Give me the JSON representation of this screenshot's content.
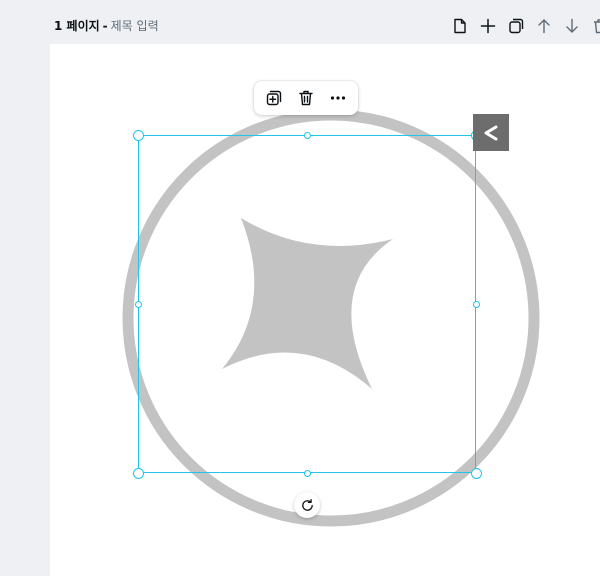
{
  "page_header": {
    "page_number": "1 페이지",
    "separator": "-",
    "title_placeholder": "제목 입력"
  },
  "page_actions": [
    {
      "name": "add-notes-button",
      "icon": "page-icon"
    },
    {
      "name": "add-page-button",
      "icon": "plus-icon"
    },
    {
      "name": "duplicate-page-button",
      "icon": "duplicate-icon"
    },
    {
      "name": "move-up-button",
      "icon": "arrow-up-icon"
    },
    {
      "name": "move-down-button",
      "icon": "arrow-down-icon"
    },
    {
      "name": "delete-page-button",
      "icon": "trash-icon"
    }
  ],
  "element_toolbar": [
    {
      "name": "duplicate-element-button",
      "icon": "duplicate-plus-icon"
    },
    {
      "name": "delete-element-button",
      "icon": "trash-icon"
    },
    {
      "name": "more-options-button",
      "icon": "more-horizontal-icon"
    }
  ],
  "colors": {
    "selection": "#1fc6e8",
    "shape_fill": "#c3c3c3",
    "canvas_bg": "#ffffff",
    "app_bg": "#eef0f3",
    "collapse_tab": "#6d6d6d"
  },
  "collapse_tab_icon": "chevron-left-icon",
  "rotate_icon": "rotate-icon"
}
